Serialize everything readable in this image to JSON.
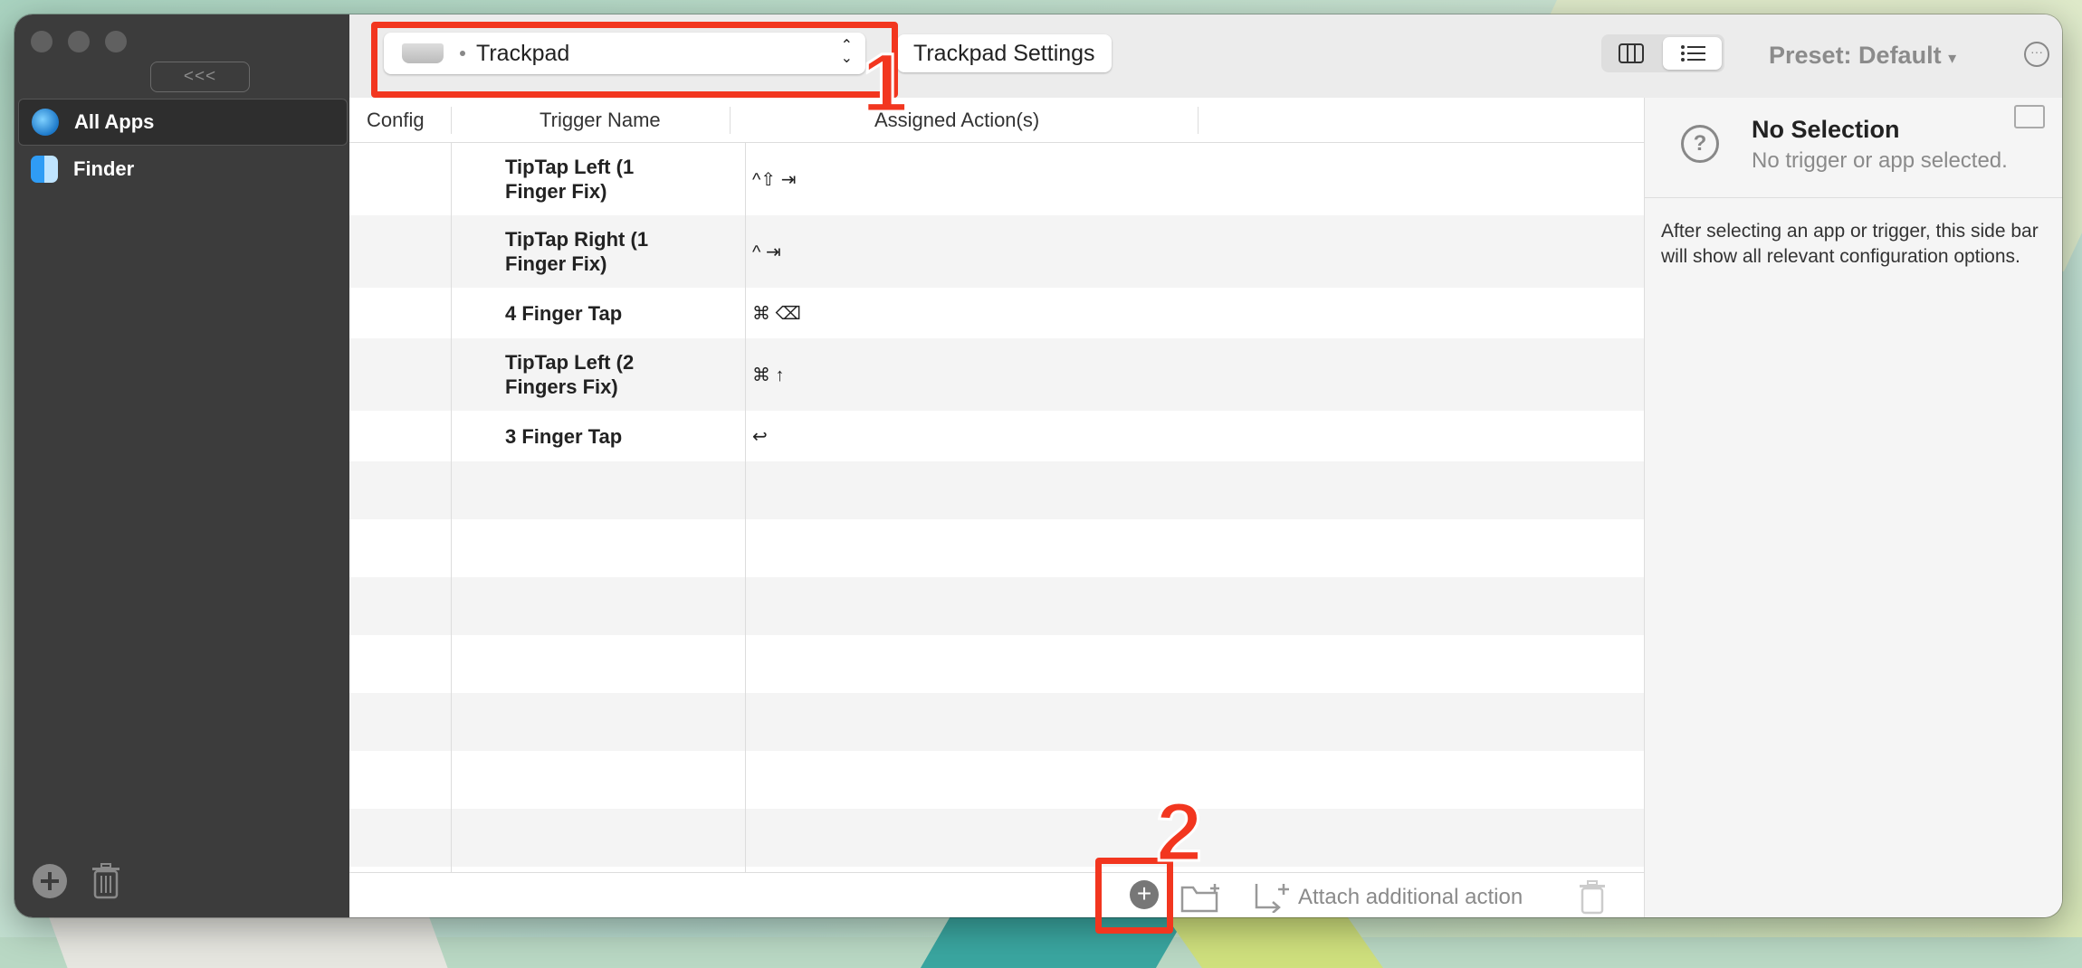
{
  "sidebar": {
    "collapse_label": "<<<",
    "apps": [
      {
        "label": "All Apps",
        "icon": "globe-icon",
        "selected": true
      },
      {
        "label": "Finder",
        "icon": "finder-icon",
        "selected": false
      }
    ]
  },
  "toolbar": {
    "device_selector": "Trackpad",
    "settings_button": "Trackpad Settings",
    "preset_label": "Preset: Default",
    "preset_caret": "▾"
  },
  "table": {
    "headers": {
      "config": "Config",
      "trigger_name": "Trigger Name",
      "assigned_actions": "Assigned Action(s)"
    },
    "rows": [
      {
        "trigger": "TipTap Left (1 Finger Fix)",
        "action": "^⇧ ⇥"
      },
      {
        "trigger": "TipTap Right (1 Finger Fix)",
        "action": "^ ⇥"
      },
      {
        "trigger": "4 Finger Tap",
        "action": "⌘ ⌫"
      },
      {
        "trigger": "TipTap Left (2 Fingers Fix)",
        "action": "⌘ ↑"
      },
      {
        "trigger": "3 Finger Tap",
        "action": "↩"
      }
    ]
  },
  "bottom_bar": {
    "attach_label": "Attach additional action"
  },
  "inspector": {
    "title": "No Selection",
    "subtitle": "No trigger or app selected.",
    "body": "After selecting an app or trigger, this side bar will show all relevant configuration options."
  },
  "annotations": {
    "callout_1": "1",
    "callout_2": "2",
    "highlight_color": "#f2361f"
  }
}
